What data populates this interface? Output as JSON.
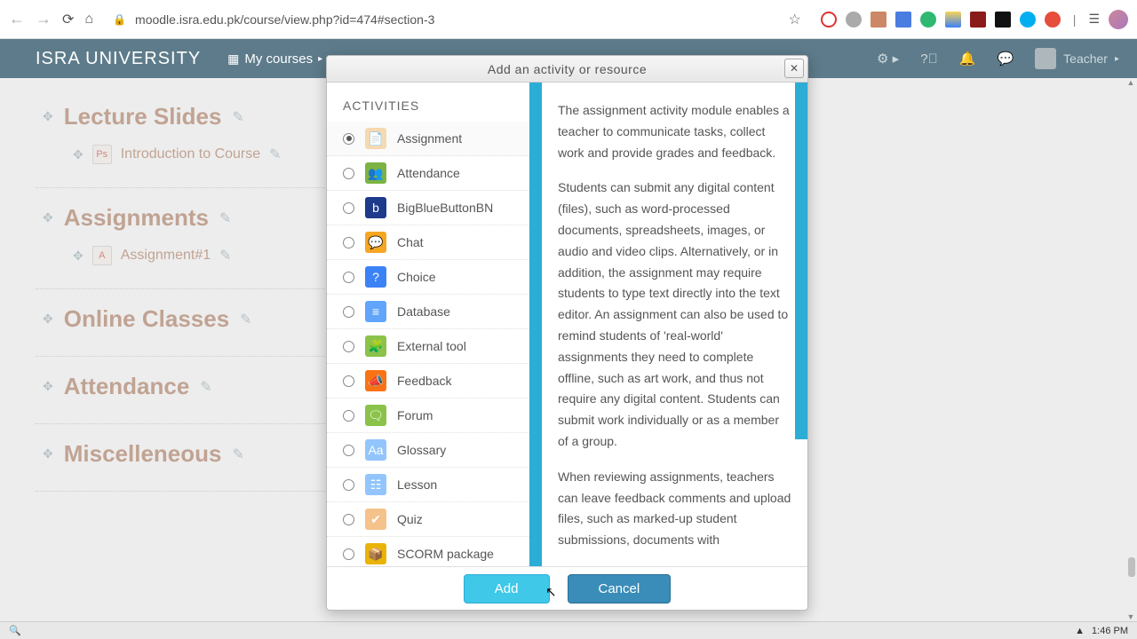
{
  "browser": {
    "url": "moodle.isra.edu.pk/course/view.php?id=474#section-3"
  },
  "header": {
    "brand": "ISRA UNIVERSITY",
    "my_courses": "My courses",
    "user": "Teacher"
  },
  "sections": [
    {
      "title": "Lecture Slides",
      "items": [
        {
          "label": "Introduction to Course",
          "icon": "Ps"
        }
      ]
    },
    {
      "title": "Assignments",
      "items": [
        {
          "label": "Assignment#1",
          "icon": "A"
        }
      ]
    },
    {
      "title": "Online Classes",
      "items": []
    },
    {
      "title": "Attendance",
      "items": []
    },
    {
      "title": "Miscelleneous",
      "items": []
    }
  ],
  "modal": {
    "title": "Add an activity or resource",
    "activities_header": "ACTIVITIES",
    "activities": [
      {
        "label": "Assignment",
        "selected": true,
        "icon_bg": "#f6d9b0",
        "icon_glyph": "📄"
      },
      {
        "label": "Attendance",
        "selected": false,
        "icon_bg": "#7cb342",
        "icon_glyph": "👥"
      },
      {
        "label": "BigBlueButtonBN",
        "selected": false,
        "icon_bg": "#1e3a8a",
        "icon_glyph": "b"
      },
      {
        "label": "Chat",
        "selected": false,
        "icon_bg": "#f5a623",
        "icon_glyph": "💬"
      },
      {
        "label": "Choice",
        "selected": false,
        "icon_bg": "#3b82f6",
        "icon_glyph": "?"
      },
      {
        "label": "Database",
        "selected": false,
        "icon_bg": "#60a5fa",
        "icon_glyph": "≡"
      },
      {
        "label": "External tool",
        "selected": false,
        "icon_bg": "#8bc34a",
        "icon_glyph": "🧩"
      },
      {
        "label": "Feedback",
        "selected": false,
        "icon_bg": "#f97316",
        "icon_glyph": "📣"
      },
      {
        "label": "Forum",
        "selected": false,
        "icon_bg": "#8bc34a",
        "icon_glyph": "🗨"
      },
      {
        "label": "Glossary",
        "selected": false,
        "icon_bg": "#93c5fd",
        "icon_glyph": "Aa"
      },
      {
        "label": "Lesson",
        "selected": false,
        "icon_bg": "#93c5fd",
        "icon_glyph": "☷"
      },
      {
        "label": "Quiz",
        "selected": false,
        "icon_bg": "#f6c28b",
        "icon_glyph": "✔"
      },
      {
        "label": "SCORM package",
        "selected": false,
        "icon_bg": "#eab308",
        "icon_glyph": "📦"
      }
    ],
    "description_p1": "The assignment activity module enables a teacher to communicate tasks, collect work and provide grades and feedback.",
    "description_p2": "Students can submit any digital content (files), such as word-processed documents, spreadsheets, images, or audio and video clips. Alternatively, or in addition, the assignment may require students to type text directly into the text editor. An assignment can also be used to remind students of 'real-world' assignments they need to complete offline, such as art work, and thus not require any digital content. Students can submit work individually or as a member of a group.",
    "description_p3": "When reviewing assignments, teachers can leave feedback comments and upload files, such as marked-up student submissions, documents with",
    "add_label": "Add",
    "cancel_label": "Cancel"
  },
  "taskbar": {
    "time": "1:46 PM"
  }
}
